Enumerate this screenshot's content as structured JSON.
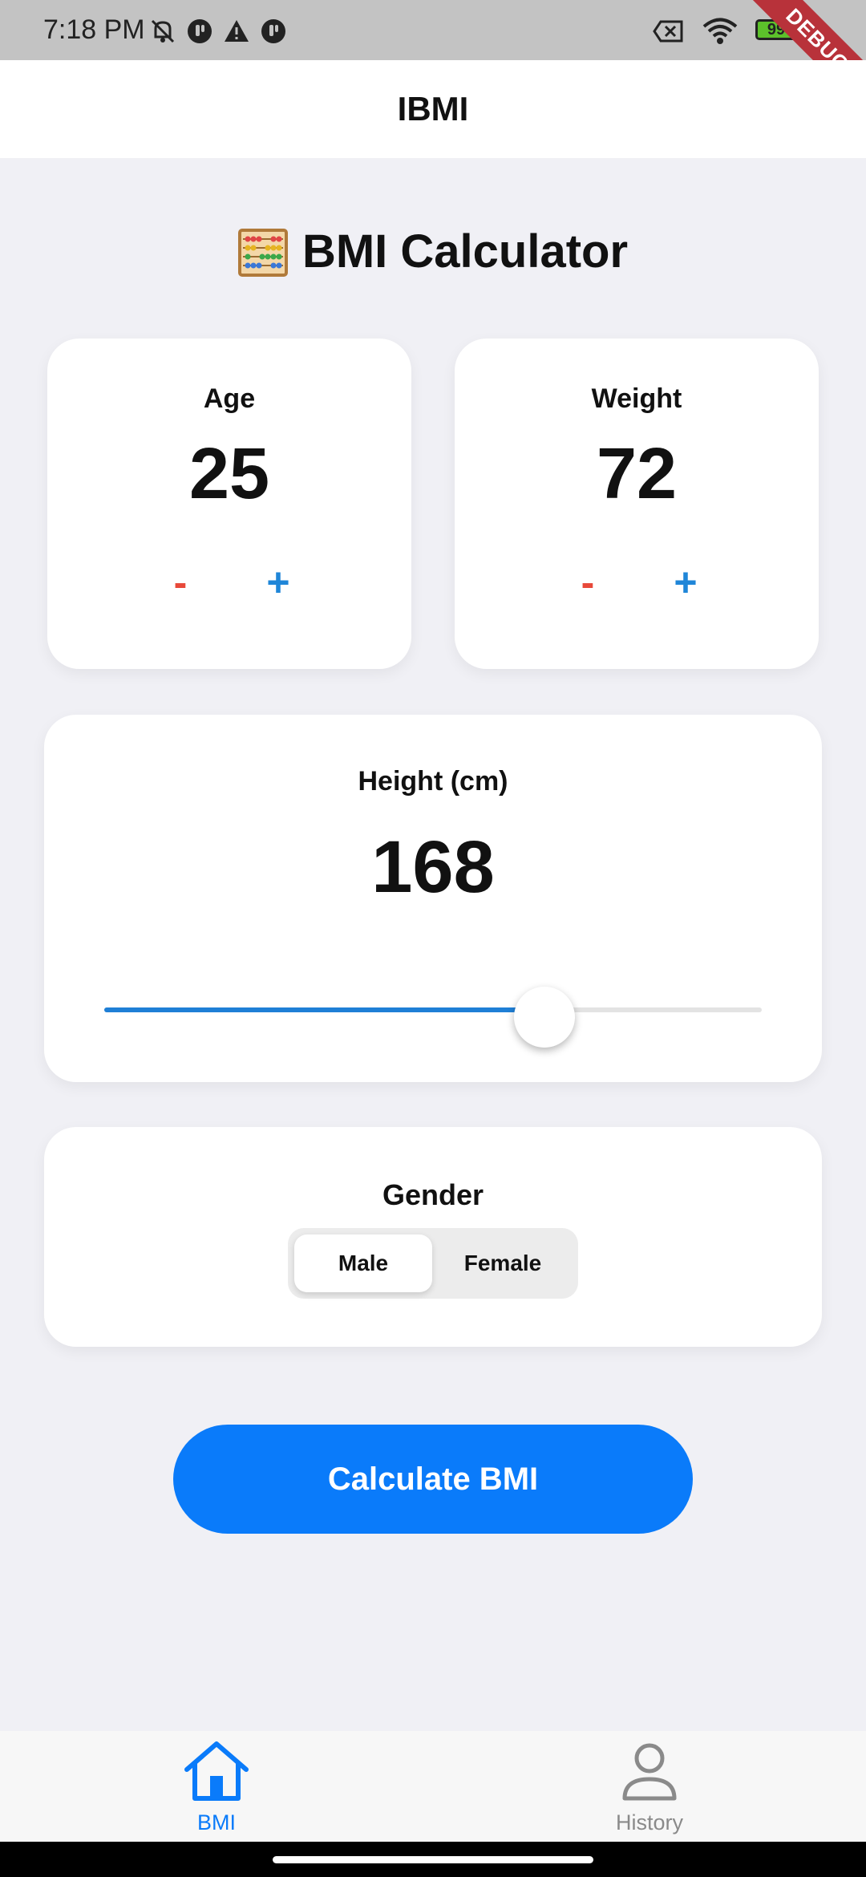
{
  "status_bar": {
    "time": "7:18 PM",
    "battery_level": "99",
    "debug_label": "DEBUG",
    "icons_left": [
      "mute-icon",
      "app-notification-icon",
      "warning-icon",
      "app-notification-icon"
    ],
    "icons_right": [
      "no-sim-icon",
      "wifi-icon",
      "battery-icon"
    ]
  },
  "app_bar": {
    "title": "IBMI"
  },
  "page": {
    "title": "BMI Calculator",
    "title_icon": "abacus-icon"
  },
  "age_card": {
    "label": "Age",
    "value": "25",
    "minus": "-",
    "plus": "+"
  },
  "weight_card": {
    "label": "Weight",
    "value": "72",
    "minus": "-",
    "plus": "+"
  },
  "height_card": {
    "label": "Height (cm)",
    "value": "168",
    "slider_fraction": 0.67
  },
  "gender_card": {
    "label": "Gender",
    "options": [
      "Male",
      "Female"
    ],
    "selected": "Male"
  },
  "calculate_button": {
    "label": "Calculate BMI"
  },
  "bottom_nav": {
    "items": [
      {
        "label": "BMI",
        "icon": "home-icon",
        "active": true
      },
      {
        "label": "History",
        "icon": "person-icon",
        "active": false
      }
    ]
  },
  "colors": {
    "accent": "#0a7bfa",
    "slider_active": "#1f7fd6",
    "minus": "#e8493a",
    "plus": "#1f86d8",
    "background": "#f0f0f5",
    "nav_inactive": "#8a8a8a",
    "debug_ribbon": "#b8323a"
  }
}
